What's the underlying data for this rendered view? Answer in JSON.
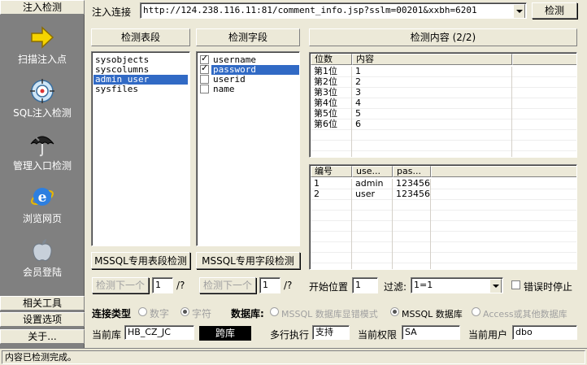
{
  "sidebar": {
    "top_label": "注入检测",
    "tools": [
      {
        "label": "扫描注入点",
        "icon": "arrow-right-icon"
      },
      {
        "label": "SQL注入检测",
        "icon": "sql-target-icon"
      },
      {
        "label": "管理入口检测",
        "icon": "umbrella-icon"
      },
      {
        "label": "浏览网页",
        "icon": "ie-browser-icon"
      },
      {
        "label": "会员登陆",
        "icon": "apple-icon"
      }
    ],
    "bottom_items": [
      "相关工具",
      "设置选项",
      "关于..."
    ]
  },
  "url_bar": {
    "label": "注入连接",
    "value": "http://124.238.116.11:81/comment_info.jsp?sslm=00201&xxbh=6201",
    "detect_button": "检测"
  },
  "tables_panel": {
    "header": "检测表段",
    "items": [
      {
        "name": "sysobjects",
        "selected": false
      },
      {
        "name": "syscolumns",
        "selected": false
      },
      {
        "name": "admin_user",
        "selected": true
      },
      {
        "name": "sysfiles",
        "selected": false
      }
    ],
    "button": "MSSQL专用表段检测"
  },
  "fields_panel": {
    "header": "检测字段",
    "items": [
      {
        "name": "username",
        "checked": true,
        "selected": false
      },
      {
        "name": "password",
        "checked": true,
        "selected": true
      },
      {
        "name": "userid",
        "checked": false,
        "selected": false
      },
      {
        "name": "name",
        "checked": false,
        "selected": false
      }
    ],
    "button": "MSSQL专用字段检测"
  },
  "content_panel": {
    "header": "检测内容 (2/2)",
    "pos_grid": {
      "columns": [
        "位数",
        "内容"
      ],
      "rows": [
        [
          "第1位",
          "1"
        ],
        [
          "第2位",
          "2"
        ],
        [
          "第3位",
          "3"
        ],
        [
          "第4位",
          "4"
        ],
        [
          "第5位",
          "5"
        ],
        [
          "第6位",
          "6"
        ]
      ]
    },
    "result_grid": {
      "columns": [
        "编号",
        "use...",
        "pas..."
      ],
      "rows": [
        [
          "1",
          "admin",
          "123456"
        ],
        [
          "2",
          "user",
          "123456"
        ]
      ]
    }
  },
  "bottom_controls": {
    "next1": {
      "label": "检测下一个",
      "value": "1",
      "suffix": "/?"
    },
    "next2": {
      "label": "检测下一个",
      "value": "1",
      "suffix": "/?"
    },
    "start_pos": {
      "label": "开始位置",
      "value": "1"
    },
    "filter": {
      "label": "过滤:",
      "value": "1=1"
    },
    "stop_on_error": {
      "label": "错误时停止",
      "checked": false
    }
  },
  "conn_type": {
    "label": "连接类型",
    "options": [
      {
        "label": "数字",
        "selected": false
      },
      {
        "label": "字符",
        "selected": true
      }
    ]
  },
  "database": {
    "label": "数据库:",
    "options": [
      {
        "label": "MSSQL 数据库显错模式",
        "selected": false
      },
      {
        "label": "MSSQL 数据库",
        "selected": true
      },
      {
        "label": "Access或其他数据库",
        "selected": false
      }
    ]
  },
  "info_row": {
    "current_db": {
      "label": "当前库",
      "value": "HB_CZ_JC"
    },
    "cross_db_button": "跨库",
    "multi_exec": {
      "label": "多行执行",
      "value": "支持"
    },
    "permission": {
      "label": "当前权限",
      "value": "SA"
    },
    "current_user": {
      "label": "当前用户",
      "value": "dbo"
    }
  },
  "status_bar": {
    "text": "内容已检测完成。"
  },
  "colors": {
    "selection": "#316ac5",
    "sidebar_bg": "#808080",
    "window_bg": "#ece9d8"
  }
}
